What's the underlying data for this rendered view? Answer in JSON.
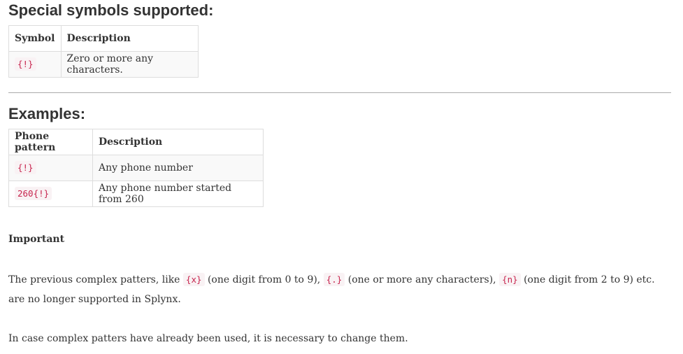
{
  "special": {
    "heading": "Special symbols supported:",
    "columns": [
      "Symbol",
      "Description"
    ],
    "rows": [
      {
        "symbol": "{!}",
        "description": "Zero or more any characters."
      }
    ]
  },
  "examples": {
    "heading": "Examples:",
    "columns": [
      "Phone pattern",
      "Description"
    ],
    "rows": [
      {
        "pattern": "{!}",
        "description": "Any phone number"
      },
      {
        "pattern": "260{!}",
        "description": "Any phone number started from 260"
      }
    ]
  },
  "important": {
    "label": "Important",
    "p1": {
      "t1": "The previous complex patters, like ",
      "c1": "{x}",
      "t2": " (one digit from 0 to 9), ",
      "c2": "{.}",
      "t3": " (one or more any characters), ",
      "c3": "{n}",
      "t4": " (one digit from 2 to 9) etc. are no longer supported in Splynx."
    },
    "p2": "In case complex patters have already been used, it is necessary to change them."
  }
}
